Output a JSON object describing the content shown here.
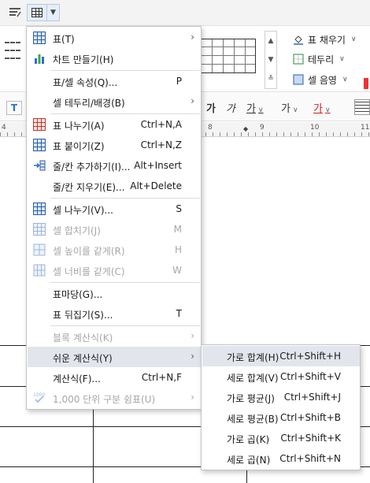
{
  "ribbon": {
    "fill_label": "표 채우기",
    "border_label": "테두리",
    "shade_label": "셀 음영"
  },
  "format_bar": {
    "glyphs": [
      "가",
      "가",
      "가",
      "가",
      "가"
    ]
  },
  "ruler": {
    "numbers": [
      "4",
      "8",
      "9",
      "10",
      "11"
    ]
  },
  "main_menu": {
    "items": [
      {
        "label": "표(T)",
        "shortcut": "",
        "submenu": true,
        "disabled": false,
        "icon": "table-icon"
      },
      {
        "label": "차트 만들기(H)",
        "shortcut": "",
        "submenu": false,
        "disabled": false,
        "icon": "chart-icon"
      },
      {
        "label": "표/셀 속성(Q)...",
        "shortcut": "P",
        "submenu": false,
        "disabled": false,
        "icon": ""
      },
      {
        "label": "셀 테두리/배경(B)",
        "shortcut": "",
        "submenu": true,
        "disabled": false,
        "icon": ""
      },
      {
        "label": "표 나누기(A)",
        "shortcut": "Ctrl+N,A",
        "submenu": false,
        "disabled": false,
        "icon": "split-table-icon"
      },
      {
        "label": "표 붙이기(Z)",
        "shortcut": "Ctrl+N,Z",
        "submenu": false,
        "disabled": false,
        "icon": "merge-table-icon"
      },
      {
        "label": "줄/칸 추가하기(I)...",
        "shortcut": "Alt+Insert",
        "submenu": false,
        "disabled": false,
        "icon": "insert-row-col-icon"
      },
      {
        "label": "줄/칸 지우기(E)...",
        "shortcut": "Alt+Delete",
        "submenu": false,
        "disabled": false,
        "icon": ""
      },
      {
        "label": "셀 나누기(V)...",
        "shortcut": "S",
        "submenu": false,
        "disabled": false,
        "icon": "split-cell-icon"
      },
      {
        "label": "셀 합치기(J)",
        "shortcut": "M",
        "submenu": false,
        "disabled": true,
        "icon": "merge-cell-icon"
      },
      {
        "label": "셀 높이를 같게(R)",
        "shortcut": "H",
        "submenu": false,
        "disabled": true,
        "icon": "equal-height-icon"
      },
      {
        "label": "셀 너비를 같게(C)",
        "shortcut": "W",
        "submenu": false,
        "disabled": true,
        "icon": "equal-width-icon"
      },
      {
        "label": "표마당(G)...",
        "shortcut": "",
        "submenu": false,
        "disabled": false,
        "icon": ""
      },
      {
        "label": "표 뒤집기(S)...",
        "shortcut": "T",
        "submenu": false,
        "disabled": false,
        "icon": ""
      },
      {
        "label": "블록 계산식(K)",
        "shortcut": "",
        "submenu": true,
        "disabled": true,
        "icon": ""
      },
      {
        "label": "쉬운 계산식(Y)",
        "shortcut": "",
        "submenu": true,
        "disabled": false,
        "icon": ""
      },
      {
        "label": "계산식(F)...",
        "shortcut": "Ctrl+N,F",
        "submenu": false,
        "disabled": false,
        "icon": ""
      },
      {
        "label": "1,000 단위 구분 쉼표(U)",
        "shortcut": "",
        "submenu": true,
        "disabled": true,
        "icon": "thousands-comma-icon"
      }
    ]
  },
  "sub_menu": {
    "items": [
      {
        "label": "가로 합계(H)",
        "shortcut": "Ctrl+Shift+H"
      },
      {
        "label": "세로 합계(V)",
        "shortcut": "Ctrl+Shift+V"
      },
      {
        "label": "가로 평균(J)",
        "shortcut": "Ctrl+Shift+J"
      },
      {
        "label": "세로 평균(B)",
        "shortcut": "Ctrl+Shift+B"
      },
      {
        "label": "가로 곱(K)",
        "shortcut": "Ctrl+Shift+K"
      },
      {
        "label": "세로 곱(N)",
        "shortcut": "Ctrl+Shift+N"
      }
    ]
  },
  "colors": {
    "accent": "#2c5fa8",
    "highlight": "#e2e6ec",
    "disabled_text": "#a6a6a6"
  }
}
